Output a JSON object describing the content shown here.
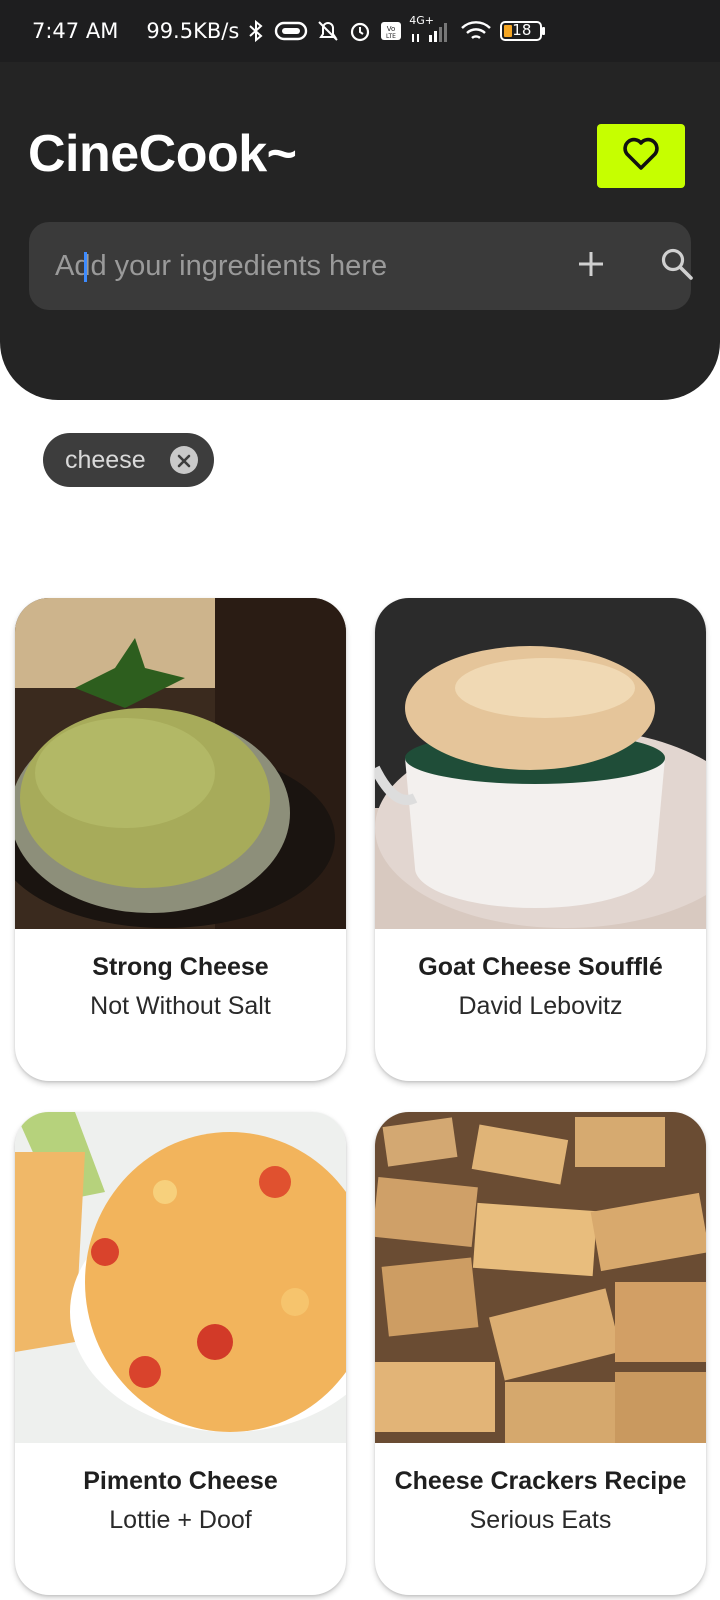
{
  "status_bar": {
    "time": "7:47 AM",
    "speed": "99.5KB/s",
    "network": "4G+",
    "battery": "18"
  },
  "app": {
    "title": "CineCook~",
    "favorites_icon": "heart-icon",
    "accent_color": "#c6ff00"
  },
  "search": {
    "placeholder": "Add your ingredients here",
    "value": "",
    "add_icon": "plus-icon",
    "search_icon": "search-icon"
  },
  "ingredients": [
    {
      "label": "cheese"
    }
  ],
  "recipes": [
    {
      "title": "Strong Cheese",
      "source": "Not Without Salt"
    },
    {
      "title": "Goat Cheese Soufflé",
      "source": "David Lebovitz"
    },
    {
      "title": "Pimento Cheese",
      "source": "Lottie + Doof"
    },
    {
      "title": "Cheese Crackers Recipe",
      "source": "Serious Eats"
    }
  ]
}
